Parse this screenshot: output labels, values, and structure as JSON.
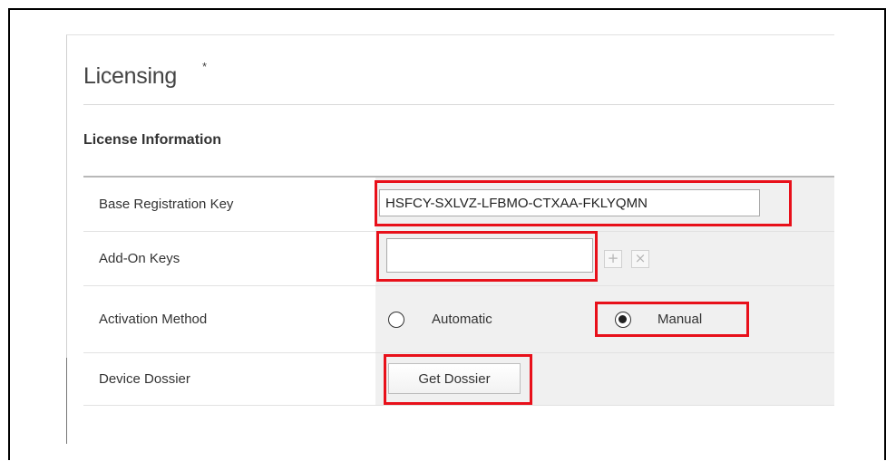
{
  "page": {
    "title": "Licensing",
    "title_marker": "*"
  },
  "section": {
    "title": "License Information"
  },
  "fields": {
    "base_key": {
      "label": "Base Registration Key",
      "value": "HSFCY-SXLVZ-LFBMO-CTXAA-FKLYQMN"
    },
    "addon_keys": {
      "label": "Add-On Keys",
      "value": "",
      "add_icon": "plus-icon",
      "remove_icon": "close-icon"
    },
    "activation": {
      "label": "Activation Method",
      "options": [
        "Automatic",
        "Manual"
      ],
      "selected": "Manual"
    },
    "dossier": {
      "label": "Device Dossier",
      "button_label": "Get Dossier"
    }
  },
  "annotations": {
    "highlight_color": "#e8101a"
  }
}
